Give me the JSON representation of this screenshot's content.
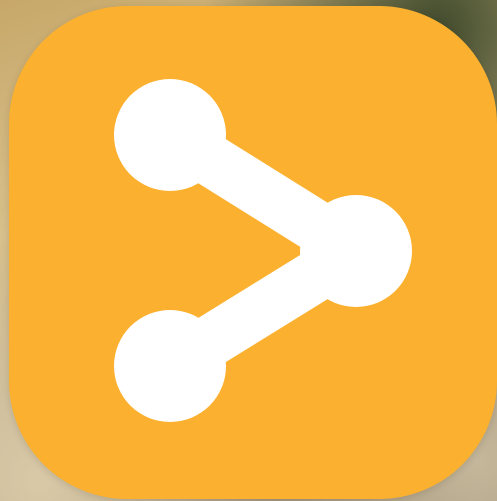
{
  "app_icon": {
    "icon_name": "share-icon",
    "background_color": "#fbb12f",
    "glyph_color": "#ffffff"
  }
}
